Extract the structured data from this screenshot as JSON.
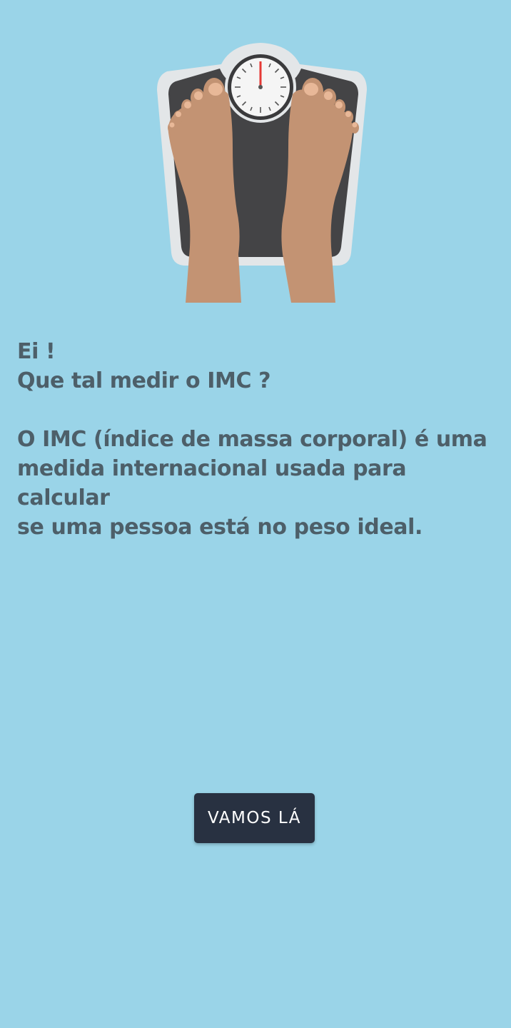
{
  "illustration": {
    "icon": "bathroom-scale-with-feet-icon",
    "colors": {
      "background": "#9ad4e8",
      "scale_frame": "#e3e6e8",
      "scale_pad": "#444446",
      "skin": "#c39373",
      "toenail": "#e8b898",
      "needle": "#e53935"
    }
  },
  "intro": {
    "greeting": "Ei !",
    "question": "Que tal medir o IMC ?",
    "description_line1": "O IMC (índice de massa corporal) é uma",
    "description_line2": "medida internacional usada para calcular",
    "description_line3": "se uma pessoa está no peso ideal."
  },
  "actions": {
    "start_label": "VAMOS LÁ"
  },
  "colors": {
    "text": "#4d5f69",
    "button_bg": "#283141",
    "button_text": "#ffffff"
  }
}
